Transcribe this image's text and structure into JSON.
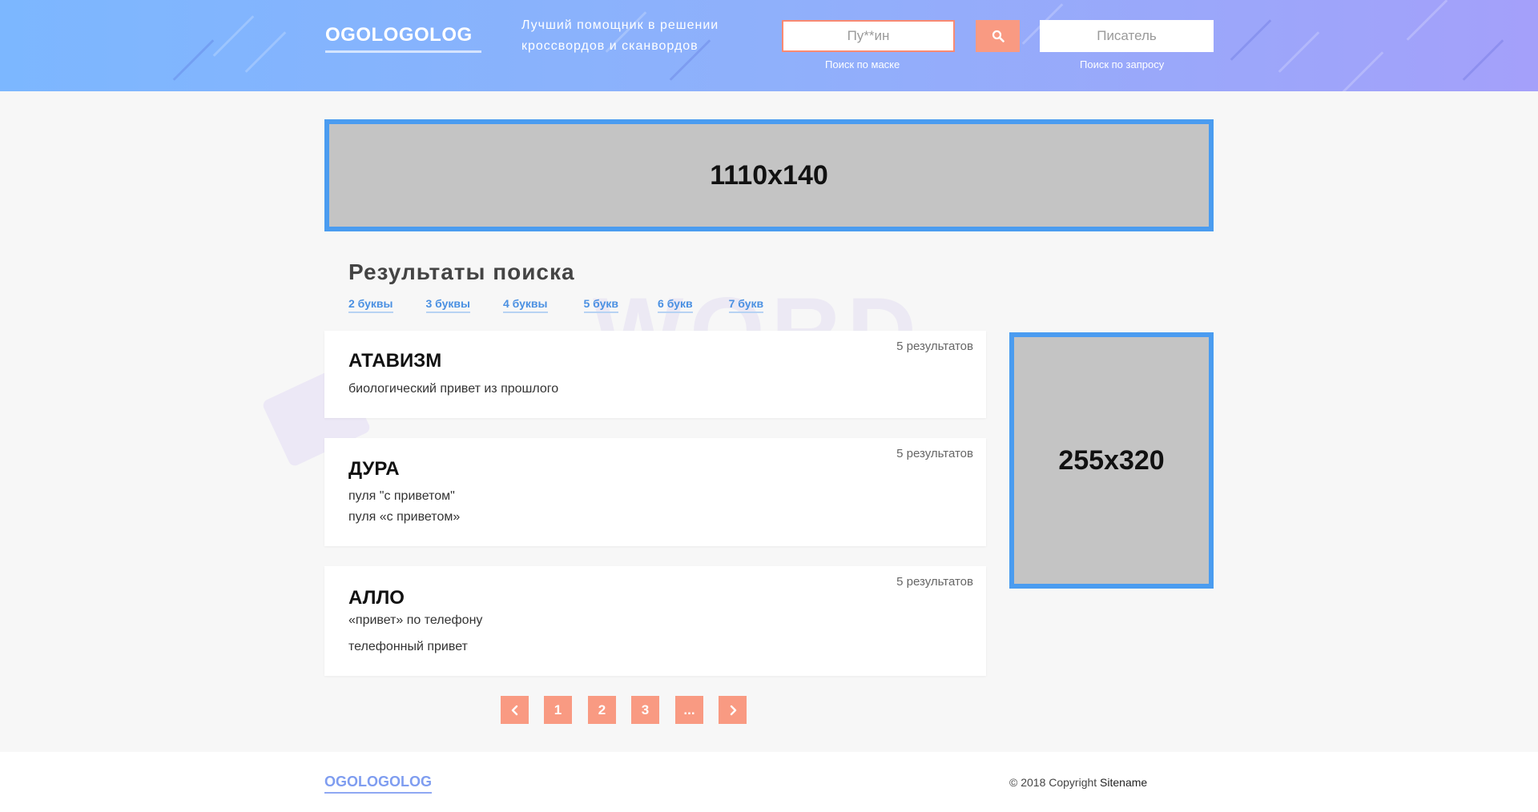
{
  "header": {
    "logo": "OGOLOGOLOG",
    "tagline": "Лучший помощник в решении кроссвордов и сканвордов",
    "mask_placeholder": "Пу**ин",
    "query_placeholder": "Писатель",
    "mask_hint": "Поиск по маске",
    "query_hint": "Поиск по запросу",
    "search_icon": "search-icon"
  },
  "banners": {
    "top": "1110x140",
    "side": "255x320"
  },
  "results": {
    "title": "Результаты поиска",
    "filters": [
      "2 буквы",
      "3 буквы",
      "4 буквы",
      "5 букв",
      "6 букв",
      "7 букв"
    ],
    "items": [
      {
        "word": "АТАВИЗМ",
        "count": "5 результатов",
        "definitions": [
          "биологический привет из прошлого"
        ]
      },
      {
        "word": "ДУРА",
        "count": "5 результатов",
        "definitions": [
          "пуля \"с приветом\"",
          "пуля «с приветом»"
        ]
      },
      {
        "word": "АЛЛО",
        "count": "5 результатов",
        "definitions": [
          "«привет» по телефону",
          "телефонный привет"
        ]
      }
    ]
  },
  "pagination": {
    "prev_icon": "chevron-left-icon",
    "pages": [
      "1",
      "2",
      "3",
      "..."
    ],
    "next_icon": "chevron-right-icon"
  },
  "decor": {
    "watermark": "WORD"
  },
  "footer": {
    "logo": "OGOLOGOLOG",
    "copyright": "© 2018 Copyright",
    "sitename": "Sitename"
  },
  "colors": {
    "accent": "#f99a82",
    "banner_border": "#4a9cf0",
    "link": "#4a90e2"
  }
}
